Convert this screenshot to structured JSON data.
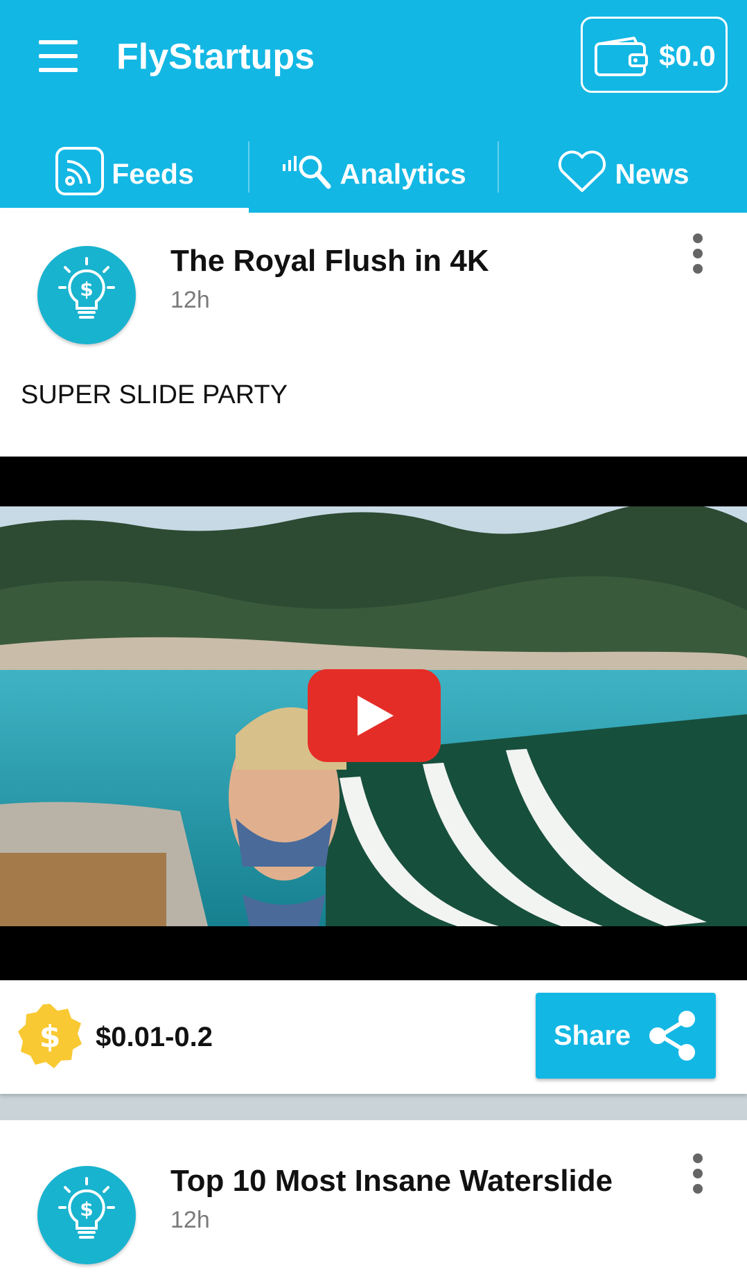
{
  "app": {
    "title": "FlyStartups",
    "wallet_amount": "$0.0",
    "accent_color": "#13b7e4"
  },
  "tabs": [
    {
      "label": "Feeds",
      "icon": "rss-icon",
      "active": true
    },
    {
      "label": "Analytics",
      "icon": "analytics-search-icon",
      "active": false
    },
    {
      "label": "News",
      "icon": "heart-icon",
      "active": false
    }
  ],
  "posts": [
    {
      "title": "The Royal Flush in 4K",
      "time": "12h",
      "text": "SUPER SLIDE PARTY",
      "avatar_icon": "lightbulb-dollar-icon",
      "media": "youtube-video",
      "reward": "$0.01-0.2",
      "share_label": "Share"
    },
    {
      "title": "Top 10 Most Insane Waterslide",
      "time": "12h",
      "avatar_icon": "lightbulb-dollar-icon"
    }
  ],
  "colors": {
    "youtube_red": "#e52d27",
    "coin_yellow": "#f9c933",
    "divider_bg": "#c9d3d8"
  }
}
